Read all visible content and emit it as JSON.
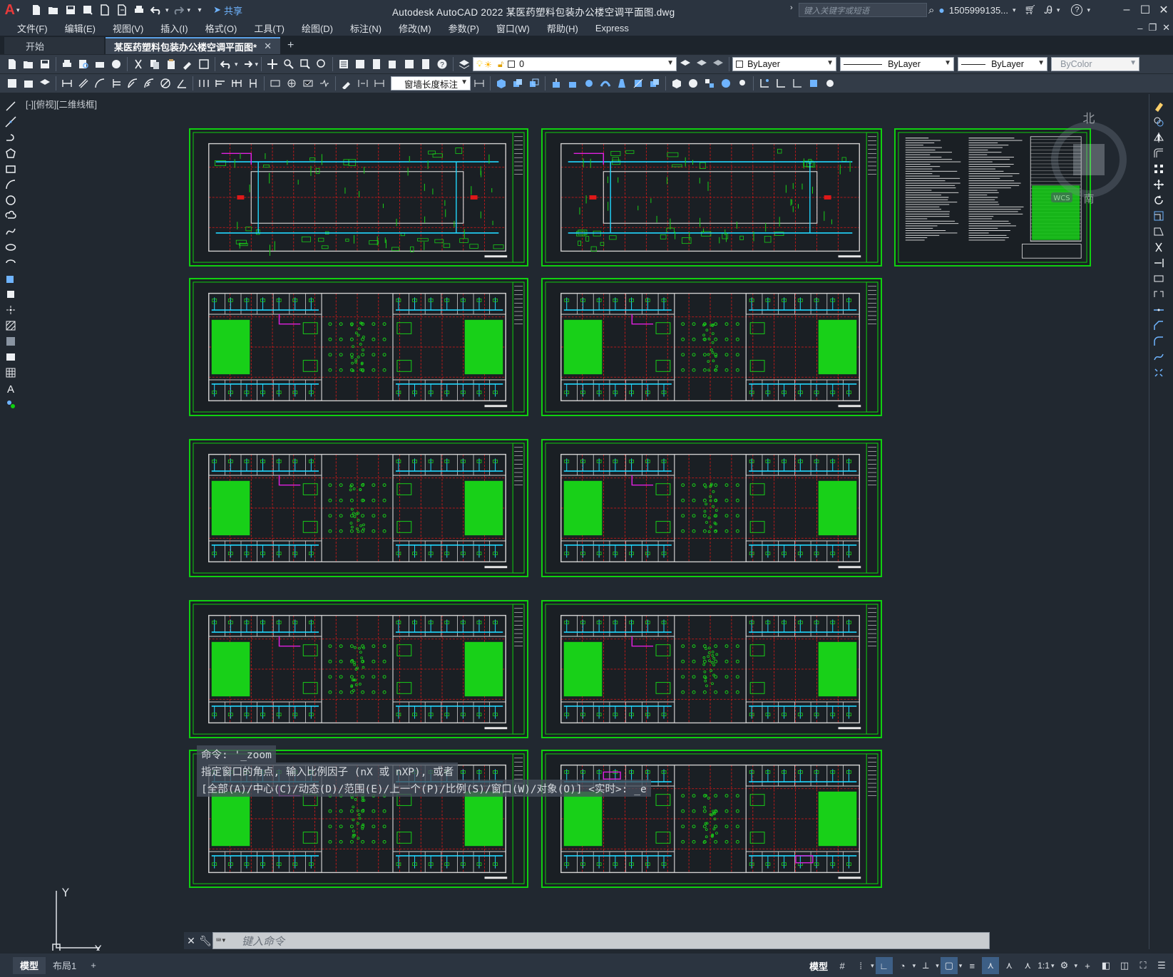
{
  "app": {
    "title": "Autodesk AutoCAD 2022    某医药塑料包装办公楼空调平面图.dwg",
    "logo": "A",
    "share_label": "共享",
    "search_placeholder": "键入关键字或短语",
    "user": "1505999135..."
  },
  "menu": [
    "文件(F)",
    "编辑(E)",
    "视图(V)",
    "插入(I)",
    "格式(O)",
    "工具(T)",
    "绘图(D)",
    "标注(N)",
    "修改(M)",
    "参数(P)",
    "窗口(W)",
    "帮助(H)",
    "Express"
  ],
  "tabs": [
    {
      "label": "开始"
    },
    {
      "label": "某医药塑料包装办公楼空调平面图*"
    }
  ],
  "toolbar": {
    "layer_value": "0",
    "color_value": "ByLayer",
    "linetype_value": "ByLayer",
    "lineweight_value": "ByLayer",
    "plotstyle_value": "ByColor",
    "dimstyle_value": "窗墙长度标注"
  },
  "viewport": {
    "label": "[-][俯视][二维线框]",
    "viewcube_north": "北",
    "viewcube_south": "南",
    "wcs_label": "WCS",
    "ucs_y": "Y",
    "ucs_x": "X"
  },
  "command": {
    "history": [
      "命令:  '_zoom",
      "指定窗口的角点, 输入比例因子 (nX 或 nXP), 或者",
      "[全部(A)/中心(C)/动态(D)/范围(E)/上一个(P)/比例(S)/窗口(W)/对象(O)] <实时>:  _e"
    ],
    "placeholder": "键入命令"
  },
  "status": {
    "model_tab": "模型",
    "layout_tab": "布局1",
    "model_label": "模型",
    "scale": "1:1"
  },
  "colors": {
    "sheet_border": "#10d010",
    "wall": "#d0d0d0",
    "grid_axis": "#e01818",
    "duct": "#22d8ff",
    "fill_green": "#18d018",
    "magenta": "#e020e0"
  }
}
